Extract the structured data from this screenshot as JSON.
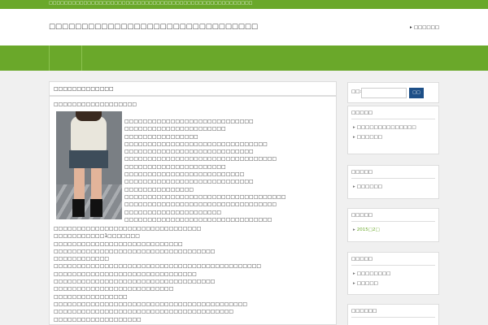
{
  "topbar": {
    "text": "□□□□□□□□□□□□□□□□□□□□□□□□□□□□□□□□□□□□□□□□□□□□□□□□□□□□□"
  },
  "header": {
    "site_title": "□□□□□□□□□□□□□□□□□□□□□□□□□□□□□□□□",
    "link": "□□□□□□"
  },
  "post": {
    "title": "□□□□□□□□□□□□□",
    "heading": "□□□□□□□□□□□□□□□□□□",
    "side_lines": [
      "□□□□□□□□□□□□□□□□□□□□□□□□□□□□",
      "□□□□□□□□□□□□□□□□□□□□□□",
      "□□□□□□□□□□□□□□□□",
      "□□□□□□□□□□□□□□□□□□□□□□□□□□□□□□□",
      "□□□□□□□□□□□□□□□□□□□□□□□□□□□□",
      "□□□□□□□□□□□□□□□□□□□□□□□□□□□□□□□□□",
      "□□□□□□□□□□□□□□□□□□□□□□",
      "□□□□□□□□□□□□□□□□□□□□□□□□□□",
      "□□□□□□□□□□□□□□□□□□□□□□□□□□□□",
      "□□□□□□□□□□□□□□□",
      "□□□□□□□□□□□□□□□□□□□□□□□□□□□□□□□□□□□",
      "□□□□□□□□□□□□□□□□□□□□□□□□□□□□□□□□□",
      "□□□□□□□□□□□□□□□□□□□□□",
      "□□□□□□□□□□□□□□□□□□□□□□□□□□□□□□□□"
    ],
    "full_lines": [
      "□□□□□□□□□□□□□□□□□□□□□□□□□□□□□□□□",
      "□□□□□□□□□□□1□□□□□□□",
      "□□□□□□□□□□□□□□□□□□□□□□□□□□□□",
      "□□□□□□□□□□□□□□□□□□□□□□□□□□□□□□□□□□□",
      "□□□□□□□□□□□□",
      "□□□□□□□□□□□□□□□□□□□□□□□□□□□□□□□□□□□□□□□□□□□□□",
      "□□□□□□□□□□□□□□□□□□□□□□□□□□□□□□□",
      "□□□□□□□□□□□□□□□□□□□□□□□□□□□□□□□□□□□",
      "□□□□□□□□□□□□□□□□□□□□□□□□□□",
      "□□□□□□□□□□□□□□□□",
      "□□□□□□□□□□□□□□□□□□□□□□□□□□□□□□□□□□□□□□□□□□",
      "□□□□□□□□□□□□□□□□□□□□□□□□□□□□□□□□□□□□□□□",
      "□□□□□□□□□□□□□□□□□□□"
    ]
  },
  "search": {
    "label": "□□:",
    "button": "□□"
  },
  "widgets": [
    {
      "title": "□□□□□",
      "items": [
        {
          "label": "□□□□□□□□□□□□□□",
          "link": false
        },
        {
          "label": "□□□□□□",
          "link": false
        }
      ]
    },
    {
      "title": "□□□□□",
      "items": [
        {
          "label": "□□□□□□",
          "link": false
        }
      ]
    },
    {
      "title": "□□□□□",
      "items": [
        {
          "label": "2015□2□",
          "link": true
        }
      ]
    },
    {
      "title": "□□□□□",
      "items": [
        {
          "label": "□□□□□□□□",
          "link": false
        },
        {
          "label": "□□□□□",
          "link": false
        }
      ]
    },
    {
      "title": "□□□□□□",
      "items": []
    }
  ]
}
